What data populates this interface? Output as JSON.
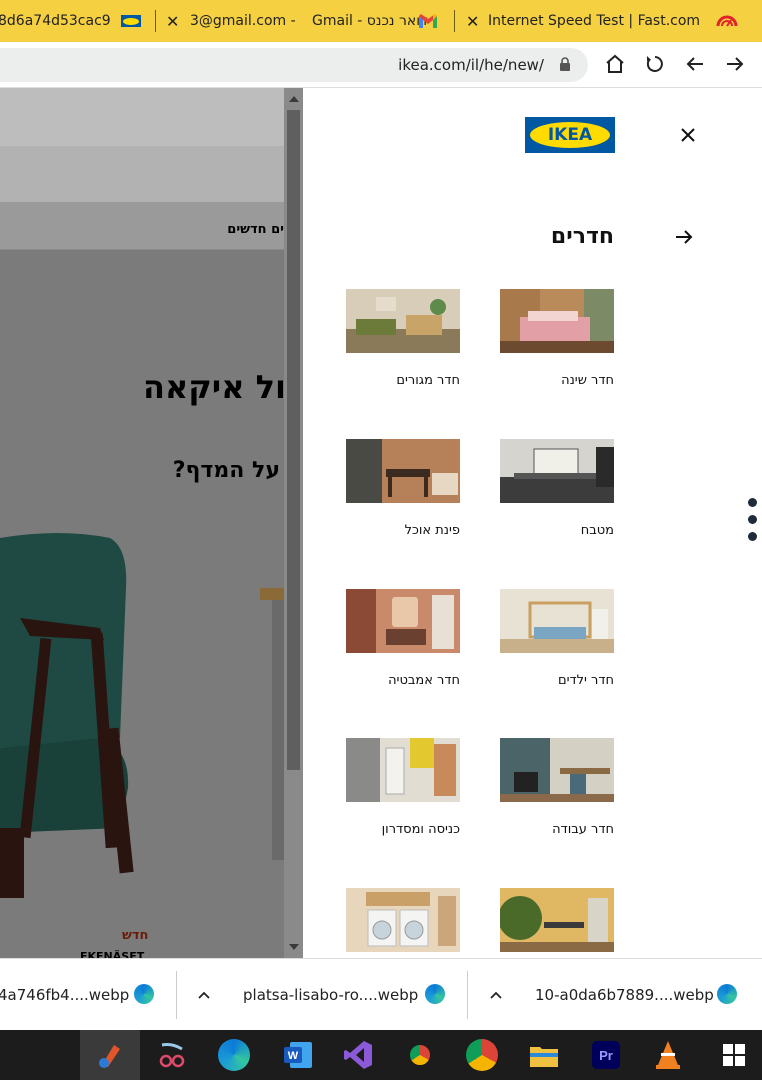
{
  "browser": {
    "tabs": [
      {
        "label": "8d6a74d53cac9",
        "icon": "ikea-favicon"
      },
      {
        "label": "דואר נכנס - Gmail",
        "prefix": "3@gmail.com -",
        "icon": "gmail-icon"
      },
      {
        "label": "Internet Speed Test | Fast.com",
        "icon": "fast-icon"
      }
    ],
    "url": "ikea.com/il/he/new/"
  },
  "page": {
    "nav_text": "ים חדשים",
    "title": "ול איקאה",
    "subtitle": "על המדף?",
    "new_badge": "חדש",
    "product_name": "EKENÄSET"
  },
  "panel": {
    "logo_text": "IKEA",
    "section_title": "חדרים",
    "rooms": [
      {
        "label": "חדר שינה",
        "image": "bedroom"
      },
      {
        "label": "חדר מגורים",
        "image": "living-room"
      },
      {
        "label": "מטבח",
        "image": "kitchen"
      },
      {
        "label": "פינת אוכל",
        "image": "dining"
      },
      {
        "label": "חדר ילדים",
        "image": "kids-room"
      },
      {
        "label": "חדר אמבטיה",
        "image": "bathroom"
      },
      {
        "label": "חדר עבודה",
        "image": "office"
      },
      {
        "label": "כניסה ומסדרון",
        "image": "hallway"
      },
      {
        "label": "",
        "image": "outdoor"
      },
      {
        "label": "",
        "image": "laundry"
      }
    ]
  },
  "downloads": [
    {
      "name": "10-a0da6b7889....webp"
    },
    {
      "name": "platsa-lisabo-ro....webp"
    },
    {
      "name": "4a746fb4....webp"
    }
  ],
  "taskbar": {
    "apps": [
      "paint-icon",
      "snip-icon",
      "edge-icon",
      "word-icon",
      "visual-studio-icon",
      "chrome-profile-icon",
      "chrome-icon",
      "file-explorer-icon",
      "premiere-icon",
      "vlc-icon",
      "windows-icon"
    ]
  }
}
